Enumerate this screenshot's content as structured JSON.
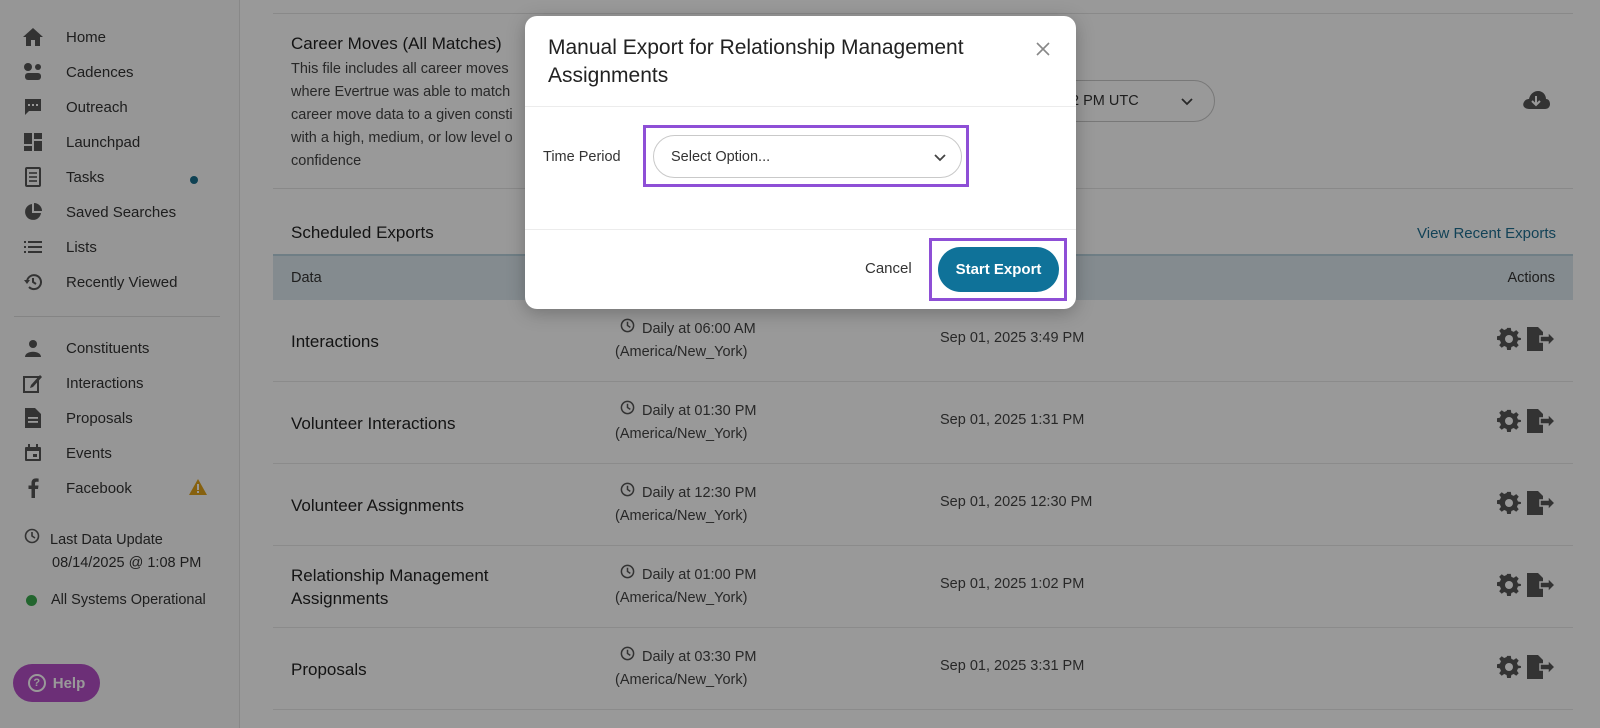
{
  "sidebar": {
    "nav_top": [
      {
        "label": "Home",
        "icon": "home-icon"
      },
      {
        "label": "Cadences",
        "icon": "cadences-icon"
      },
      {
        "label": "Outreach",
        "icon": "chat-icon"
      },
      {
        "label": "Launchpad",
        "icon": "dashboard-icon"
      },
      {
        "label": "Tasks",
        "icon": "tasks-icon"
      },
      {
        "label": "Saved Searches",
        "icon": "pie-chart-icon"
      },
      {
        "label": "Lists",
        "icon": "list-icon"
      },
      {
        "label": "Recently Viewed",
        "icon": "history-icon"
      }
    ],
    "nav_bottom": [
      {
        "label": "Constituents",
        "icon": "person-icon"
      },
      {
        "label": "Interactions",
        "icon": "edit-icon"
      },
      {
        "label": "Proposals",
        "icon": "document-icon"
      },
      {
        "label": "Events",
        "icon": "calendar-icon"
      },
      {
        "label": "Facebook",
        "icon": "facebook-icon"
      }
    ],
    "last_update_label": "Last Data Update",
    "last_update_value": "08/14/2025 @ 1:08 PM",
    "system_status": "All Systems Operational",
    "help_label": "Help"
  },
  "main": {
    "career": {
      "title": "Career Moves (All Matches)",
      "description_lines": [
        "This file includes all career moves",
        "where Evertrue was able to match",
        "career move data to a given consti",
        "with a high, medium, or low level o",
        "confidence"
      ],
      "schedule_value": "2 PM UTC"
    },
    "scheduled_exports_title": "Scheduled Exports",
    "view_recent_label": "View Recent Exports",
    "table": {
      "col_data": "Data",
      "col_actions": "Actions",
      "rows": [
        {
          "name": "Interactions",
          "schedule": "Daily at 06:00 AM",
          "tz": "(America/New_York)",
          "last": "Sep 01, 2025 3:49 PM"
        },
        {
          "name": "Volunteer Interactions",
          "schedule": "Daily at 01:30 PM",
          "tz": "(America/New_York)",
          "last": "Sep 01, 2025 1:31 PM"
        },
        {
          "name": "Volunteer Assignments",
          "schedule": "Daily at 12:30 PM",
          "tz": "(America/New_York)",
          "last": "Sep 01, 2025 12:30 PM"
        },
        {
          "name": "Relationship Management Assignments",
          "schedule": "Daily at 01:00 PM",
          "tz": "(America/New_York)",
          "last": "Sep 01, 2025 1:02 PM"
        },
        {
          "name": "Proposals",
          "schedule": "Daily at 03:30 PM",
          "tz": "(America/New_York)",
          "last": "Sep 01, 2025 3:31 PM"
        }
      ]
    }
  },
  "modal": {
    "title": "Manual Export for Relationship Management Assignments",
    "time_period_label": "Time Period",
    "select_placeholder": "Select Option...",
    "cancel_label": "Cancel",
    "start_label": "Start Export"
  },
  "colors": {
    "accent": "#0f7299",
    "highlight": "#8e4fd6",
    "help": "#b54fc6",
    "status_ok": "#3aa84d",
    "warning": "#e0a21a"
  }
}
